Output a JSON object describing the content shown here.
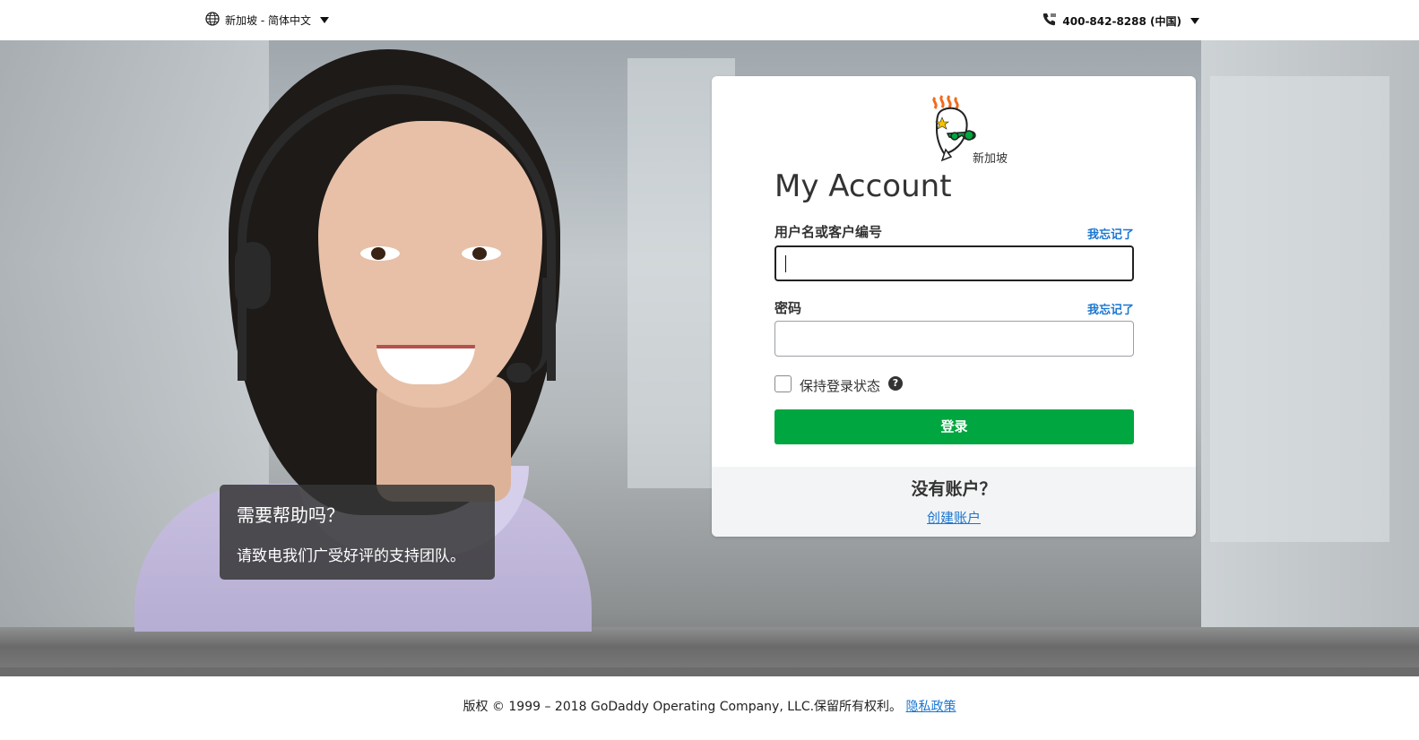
{
  "header": {
    "locale_label": "新加坡 - 简体中文",
    "phone_label": "400-842-8288 (中国)"
  },
  "help_box": {
    "title": "需要帮助吗？",
    "text": "请致电我们广受好评的支持团队。"
  },
  "login": {
    "logo_label": "新加坡",
    "title": "My Account",
    "username_label": "用户名或客户编号",
    "username_forgot": "我忘记了",
    "username_value": "",
    "password_label": "密码",
    "password_forgot": "我忘记了",
    "password_value": "",
    "remember_label": "保持登录状态",
    "remember_checked": false,
    "help_glyph": "?",
    "submit_label": "登录",
    "no_account": "没有账户？",
    "create_account": "创建账户"
  },
  "footer": {
    "copyright": "版权 © 1999 – 2018 GoDaddy Operating Company, LLC.保留所有权利。",
    "privacy_link": "隐私政策"
  },
  "colors": {
    "accent_green": "#00a63f",
    "link_blue": "#1976d2"
  },
  "icons": {
    "globe": "globe-icon",
    "phone": "phone-icon",
    "caret": "caret-down-icon",
    "logo": "godaddy-guy-logo",
    "help": "question-circle-icon"
  }
}
